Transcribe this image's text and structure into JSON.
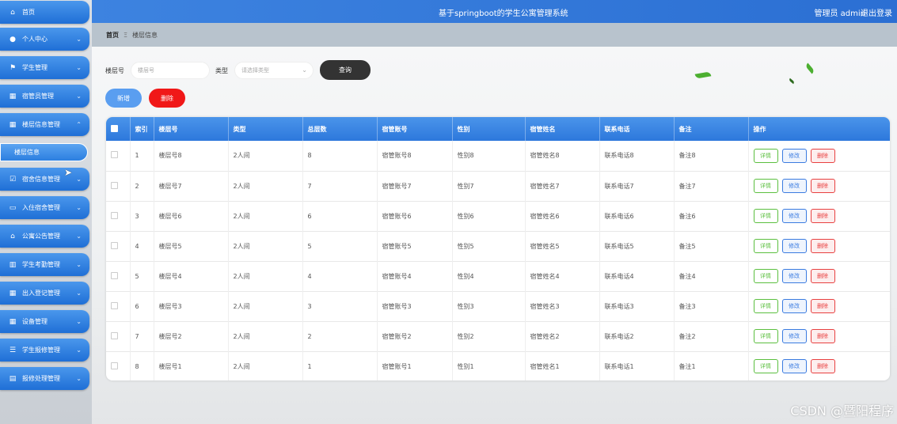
{
  "header": {
    "title": "基于springboot的学生公寓管理系统",
    "user": "管理员 admin",
    "logout": "退出登录"
  },
  "breadcrumb": {
    "home": "首页",
    "separator": "Ξ",
    "current": "楼层信息"
  },
  "sidebar": {
    "items": [
      {
        "icon": "home-icon",
        "glyph": "⌂",
        "label": "首页",
        "chevron": ""
      },
      {
        "icon": "user-icon",
        "glyph": "●",
        "label": "个人中心",
        "chevron": "⌄"
      },
      {
        "icon": "flag-icon",
        "glyph": "⚑",
        "label": "学生管理",
        "chevron": "⌄"
      },
      {
        "icon": "grid-icon",
        "glyph": "▦",
        "label": "宿管员管理",
        "chevron": "⌄"
      },
      {
        "icon": "grid-icon",
        "glyph": "▦",
        "label": "楼层信息管理",
        "chevron": "⌃"
      },
      {
        "icon": "check-icon",
        "glyph": "☑",
        "label": "宿舍信息管理",
        "chevron": "⌄"
      },
      {
        "icon": "monitor-icon",
        "glyph": "▭",
        "label": "入住宿舍管理",
        "chevron": "⌄"
      },
      {
        "icon": "bank-icon",
        "glyph": "⌂",
        "label": "公寓公告管理",
        "chevron": "⌄"
      },
      {
        "icon": "chart-icon",
        "glyph": "▥",
        "label": "学生考勤管理",
        "chevron": "⌄"
      },
      {
        "icon": "grid-icon",
        "glyph": "▦",
        "label": "出入登记管理",
        "chevron": "⌄"
      },
      {
        "icon": "grid-icon",
        "glyph": "▦",
        "label": "设备管理",
        "chevron": "⌄"
      },
      {
        "icon": "list-icon",
        "glyph": "☰",
        "label": "学生报修管理",
        "chevron": "⌄"
      },
      {
        "icon": "doc-icon",
        "glyph": "▤",
        "label": "报修处理管理",
        "chevron": "⌄"
      }
    ],
    "submenu_label": "楼层信息"
  },
  "search": {
    "floor_label": "楼层号",
    "floor_placeholder": "楼层号",
    "type_label": "类型",
    "type_placeholder": "请选择类型",
    "query_button": "查询"
  },
  "actions": {
    "add": "新增",
    "delete": "删除"
  },
  "table": {
    "columns": [
      "索引",
      "楼层号",
      "类型",
      "总层数",
      "宿管账号",
      "性别",
      "宿管姓名",
      "联系电话",
      "备注",
      "操作"
    ],
    "rows": [
      {
        "idx": "1",
        "floor": "楼层号8",
        "type": "2人间",
        "total": "8",
        "account": "宿管账号8",
        "gender": "性别8",
        "name": "宿管姓名8",
        "phone": "联系电话8",
        "note": "备注8"
      },
      {
        "idx": "2",
        "floor": "楼层号7",
        "type": "2人间",
        "total": "7",
        "account": "宿管账号7",
        "gender": "性别7",
        "name": "宿管姓名7",
        "phone": "联系电话7",
        "note": "备注7"
      },
      {
        "idx": "3",
        "floor": "楼层号6",
        "type": "2人间",
        "total": "6",
        "account": "宿管账号6",
        "gender": "性别6",
        "name": "宿管姓名6",
        "phone": "联系电话6",
        "note": "备注6"
      },
      {
        "idx": "4",
        "floor": "楼层号5",
        "type": "2人间",
        "total": "5",
        "account": "宿管账号5",
        "gender": "性别5",
        "name": "宿管姓名5",
        "phone": "联系电话5",
        "note": "备注5"
      },
      {
        "idx": "5",
        "floor": "楼层号4",
        "type": "2人间",
        "total": "4",
        "account": "宿管账号4",
        "gender": "性别4",
        "name": "宿管姓名4",
        "phone": "联系电话4",
        "note": "备注4"
      },
      {
        "idx": "6",
        "floor": "楼层号3",
        "type": "2人间",
        "total": "3",
        "account": "宿管账号3",
        "gender": "性别3",
        "name": "宿管姓名3",
        "phone": "联系电话3",
        "note": "备注3"
      },
      {
        "idx": "7",
        "floor": "楼层号2",
        "type": "2人间",
        "total": "2",
        "account": "宿管账号2",
        "gender": "性别2",
        "name": "宿管姓名2",
        "phone": "联系电话2",
        "note": "备注2"
      },
      {
        "idx": "8",
        "floor": "楼层号1",
        "type": "2人间",
        "total": "1",
        "account": "宿管账号1",
        "gender": "性别1",
        "name": "宿管姓名1",
        "phone": "联系电话1",
        "note": "备注1"
      }
    ],
    "op_labels": {
      "detail": "详情",
      "edit": "修改",
      "remove": "删除"
    }
  },
  "watermark": "CSDN @暨阳程序",
  "colors": {
    "accent": "#2d78dc",
    "danger": "#f01818",
    "query": "#333333"
  }
}
